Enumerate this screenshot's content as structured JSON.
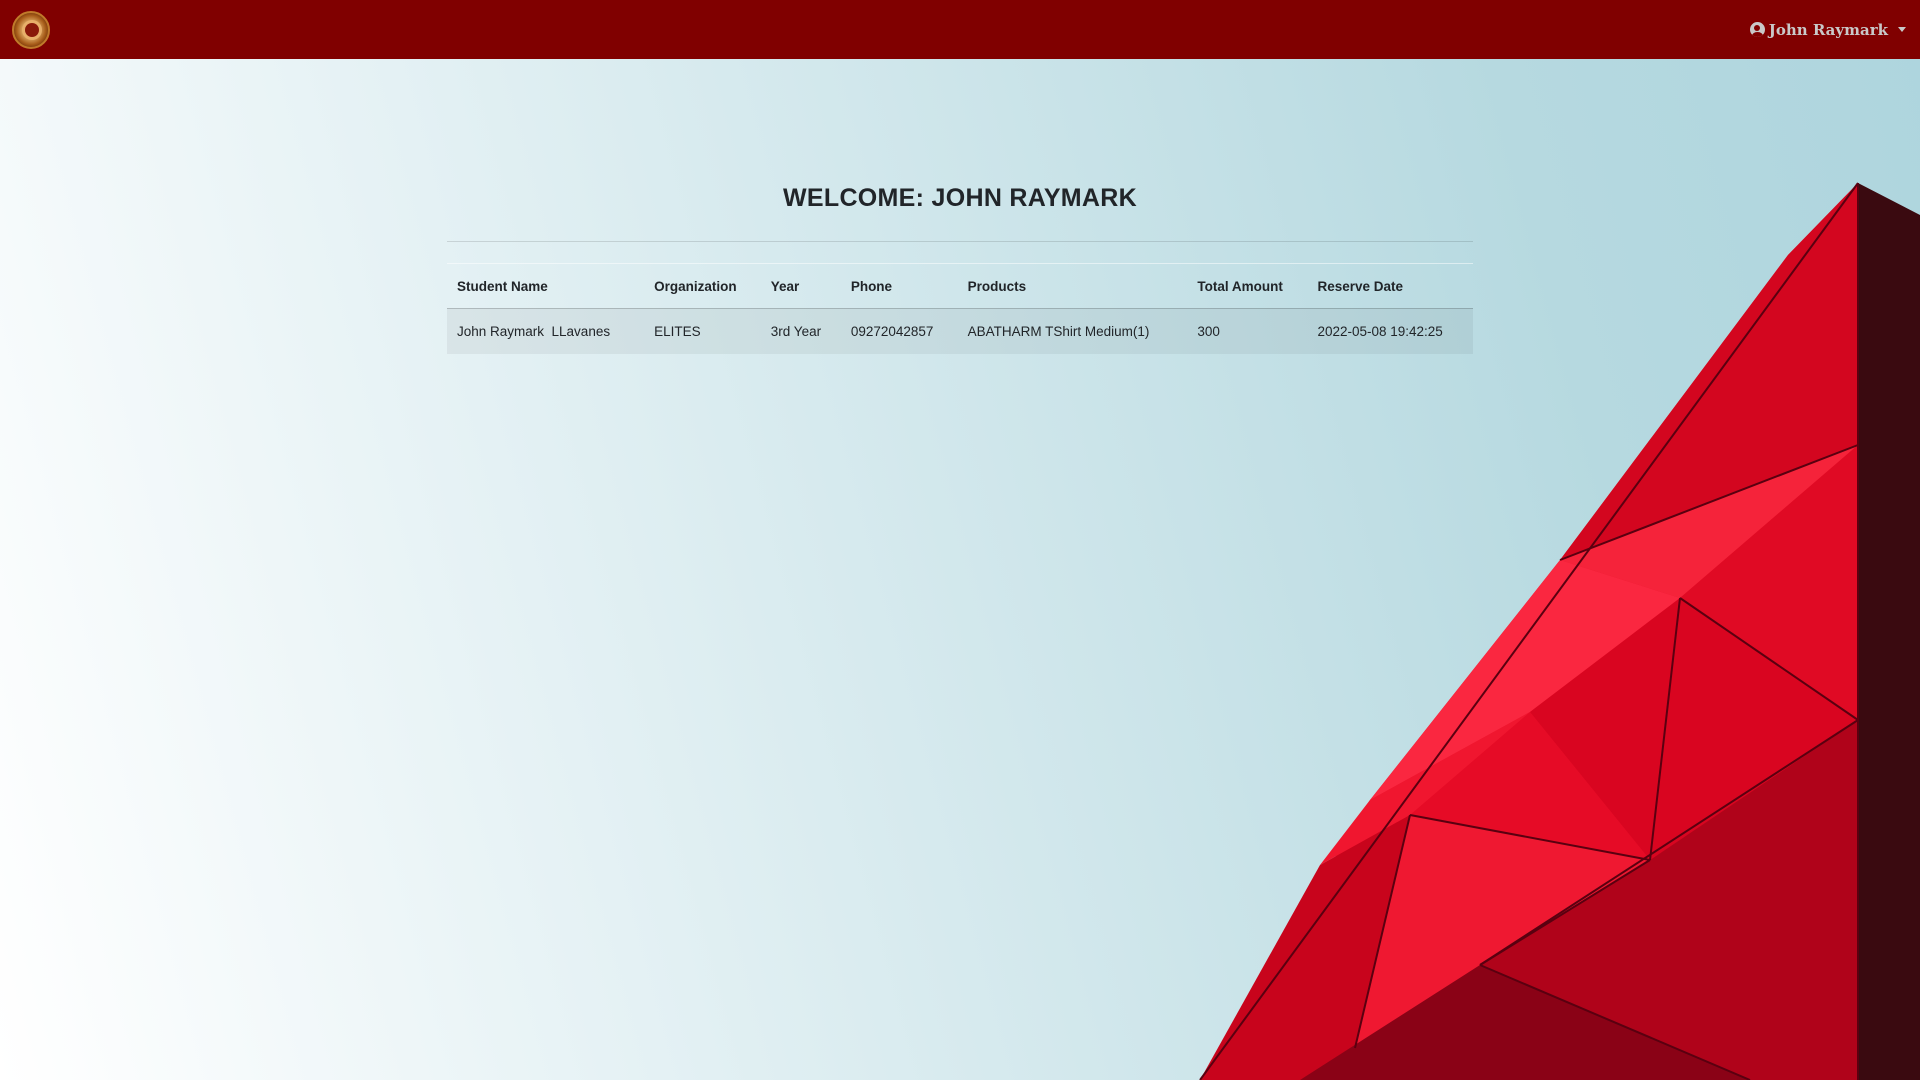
{
  "navbar": {
    "logo_icon": "org-seal-icon",
    "user_name": "John Raymark",
    "user_icon": "user-circle-icon",
    "bar_color": "#800000"
  },
  "main": {
    "title": "WELCOME: JOHN RAYMARK",
    "table": {
      "headers": {
        "student_name": "Student Name",
        "organization": "Organization",
        "year": "Year",
        "phone": "Phone",
        "products": "Products",
        "total_amount": "Total Amount",
        "reserve_date": "Reserve Date"
      },
      "rows": [
        {
          "student_name": "John Raymark  LLavanes",
          "organization": "ELITES",
          "year": "3rd Year",
          "phone": "09272042857",
          "products": "ABATHARM TShirt Medium(1)",
          "total_amount": "300",
          "reserve_date": "2022-05-08 19:42:25"
        }
      ]
    }
  }
}
